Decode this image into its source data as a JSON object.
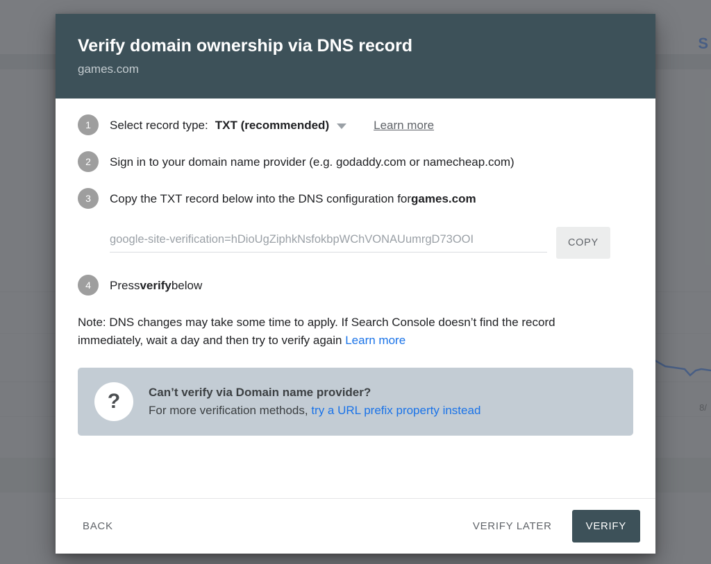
{
  "background": {
    "partial_label": "S",
    "chart_date_label": "8/"
  },
  "modal": {
    "title": "Verify domain ownership via DNS record",
    "subtitle": "games.com",
    "steps": [
      {
        "number": "1",
        "label": "Select record type:",
        "select_value": "TXT (recommended)",
        "link_label": "Learn more"
      },
      {
        "number": "2",
        "label": "Sign in to your domain name provider (e.g. godaddy.com or namecheap.com)"
      },
      {
        "number": "3",
        "label_prefix": "Copy the TXT record below into the DNS configuration for ",
        "label_bold": "games.com"
      },
      {
        "number": "4",
        "label_prefix": "Press ",
        "label_bold": "verify",
        "label_suffix": " below"
      }
    ],
    "token": {
      "value": "google-site-verification=hDioUgZiphkNsfokbpWChVONAUumrgD73OOI",
      "copy_label": "COPY"
    },
    "note": {
      "text": "Note: DNS changes may take some time to apply. If Search Console doesn’t find the record immediately, wait a day and then try to verify again ",
      "link_label": "Learn more"
    },
    "infobox": {
      "icon": "question-mark-icon",
      "icon_glyph": "?",
      "title": "Can’t verify via Domain name provider?",
      "sub_prefix": "For more verification methods, ",
      "link_label": "try a URL prefix property instead"
    },
    "footer": {
      "back_label": "BACK",
      "verify_later_label": "VERIFY LATER",
      "verify_label": "VERIFY"
    }
  },
  "colors": {
    "header_bg": "#3d5159",
    "primary_button": "#3d5159",
    "link_blue": "#1a73e8",
    "badge_grey": "#9e9e9e",
    "infobox_bg": "#c3ccd4",
    "overlay": "#7b7e81"
  }
}
